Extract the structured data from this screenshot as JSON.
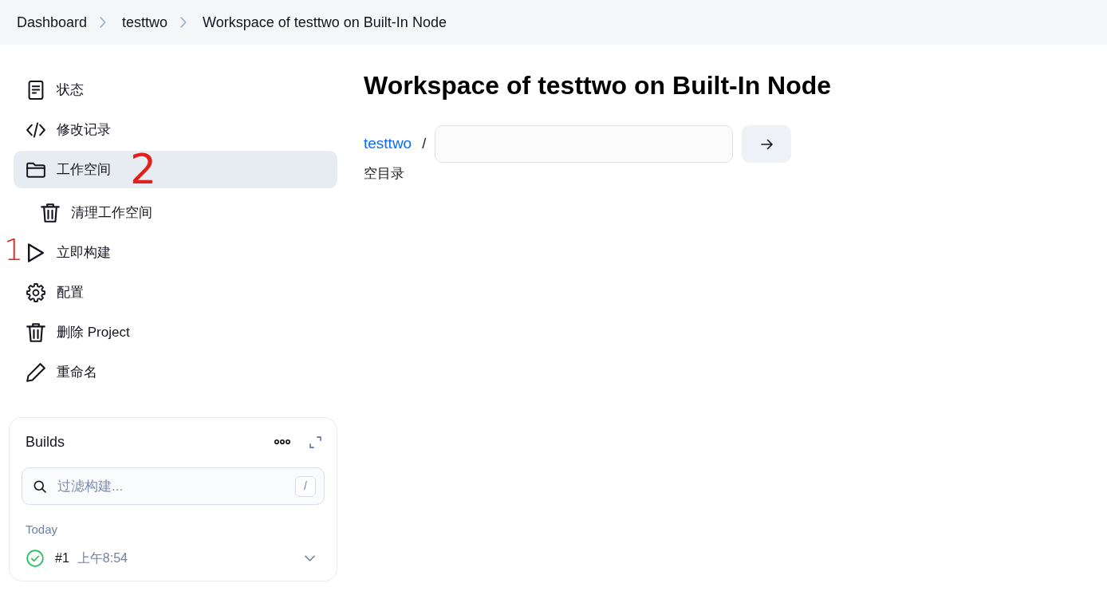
{
  "breadcrumbs": [
    {
      "label": "Dashboard"
    },
    {
      "label": "testtwo"
    },
    {
      "label": "Workspace of testtwo on Built-In Node"
    }
  ],
  "sidebar": {
    "items": [
      {
        "label": "状态",
        "selected": false
      },
      {
        "label": "修改记录",
        "selected": false
      },
      {
        "label": "工作空间",
        "selected": true,
        "annotation": "2",
        "children": [
          {
            "label": "清理工作空间",
            "selected": false
          }
        ]
      },
      {
        "label": "立即构建",
        "selected": false,
        "annotation": "1"
      },
      {
        "label": "配置",
        "selected": false
      },
      {
        "label": "删除 Project",
        "selected": false
      },
      {
        "label": "重命名",
        "selected": false
      }
    ]
  },
  "builds": {
    "title": "Builds",
    "filter": {
      "placeholder": "过滤构建...",
      "shortcut_key": "/"
    },
    "groups": [
      {
        "label": "Today",
        "builds": [
          {
            "number": "#1",
            "time": "上午8:54",
            "succeeded": true
          }
        ]
      }
    ]
  },
  "main": {
    "title": "Workspace of testtwo on Built-In Node",
    "path": {
      "link": "testtwo",
      "separator": "/"
    },
    "empty_message": "空目录"
  }
}
